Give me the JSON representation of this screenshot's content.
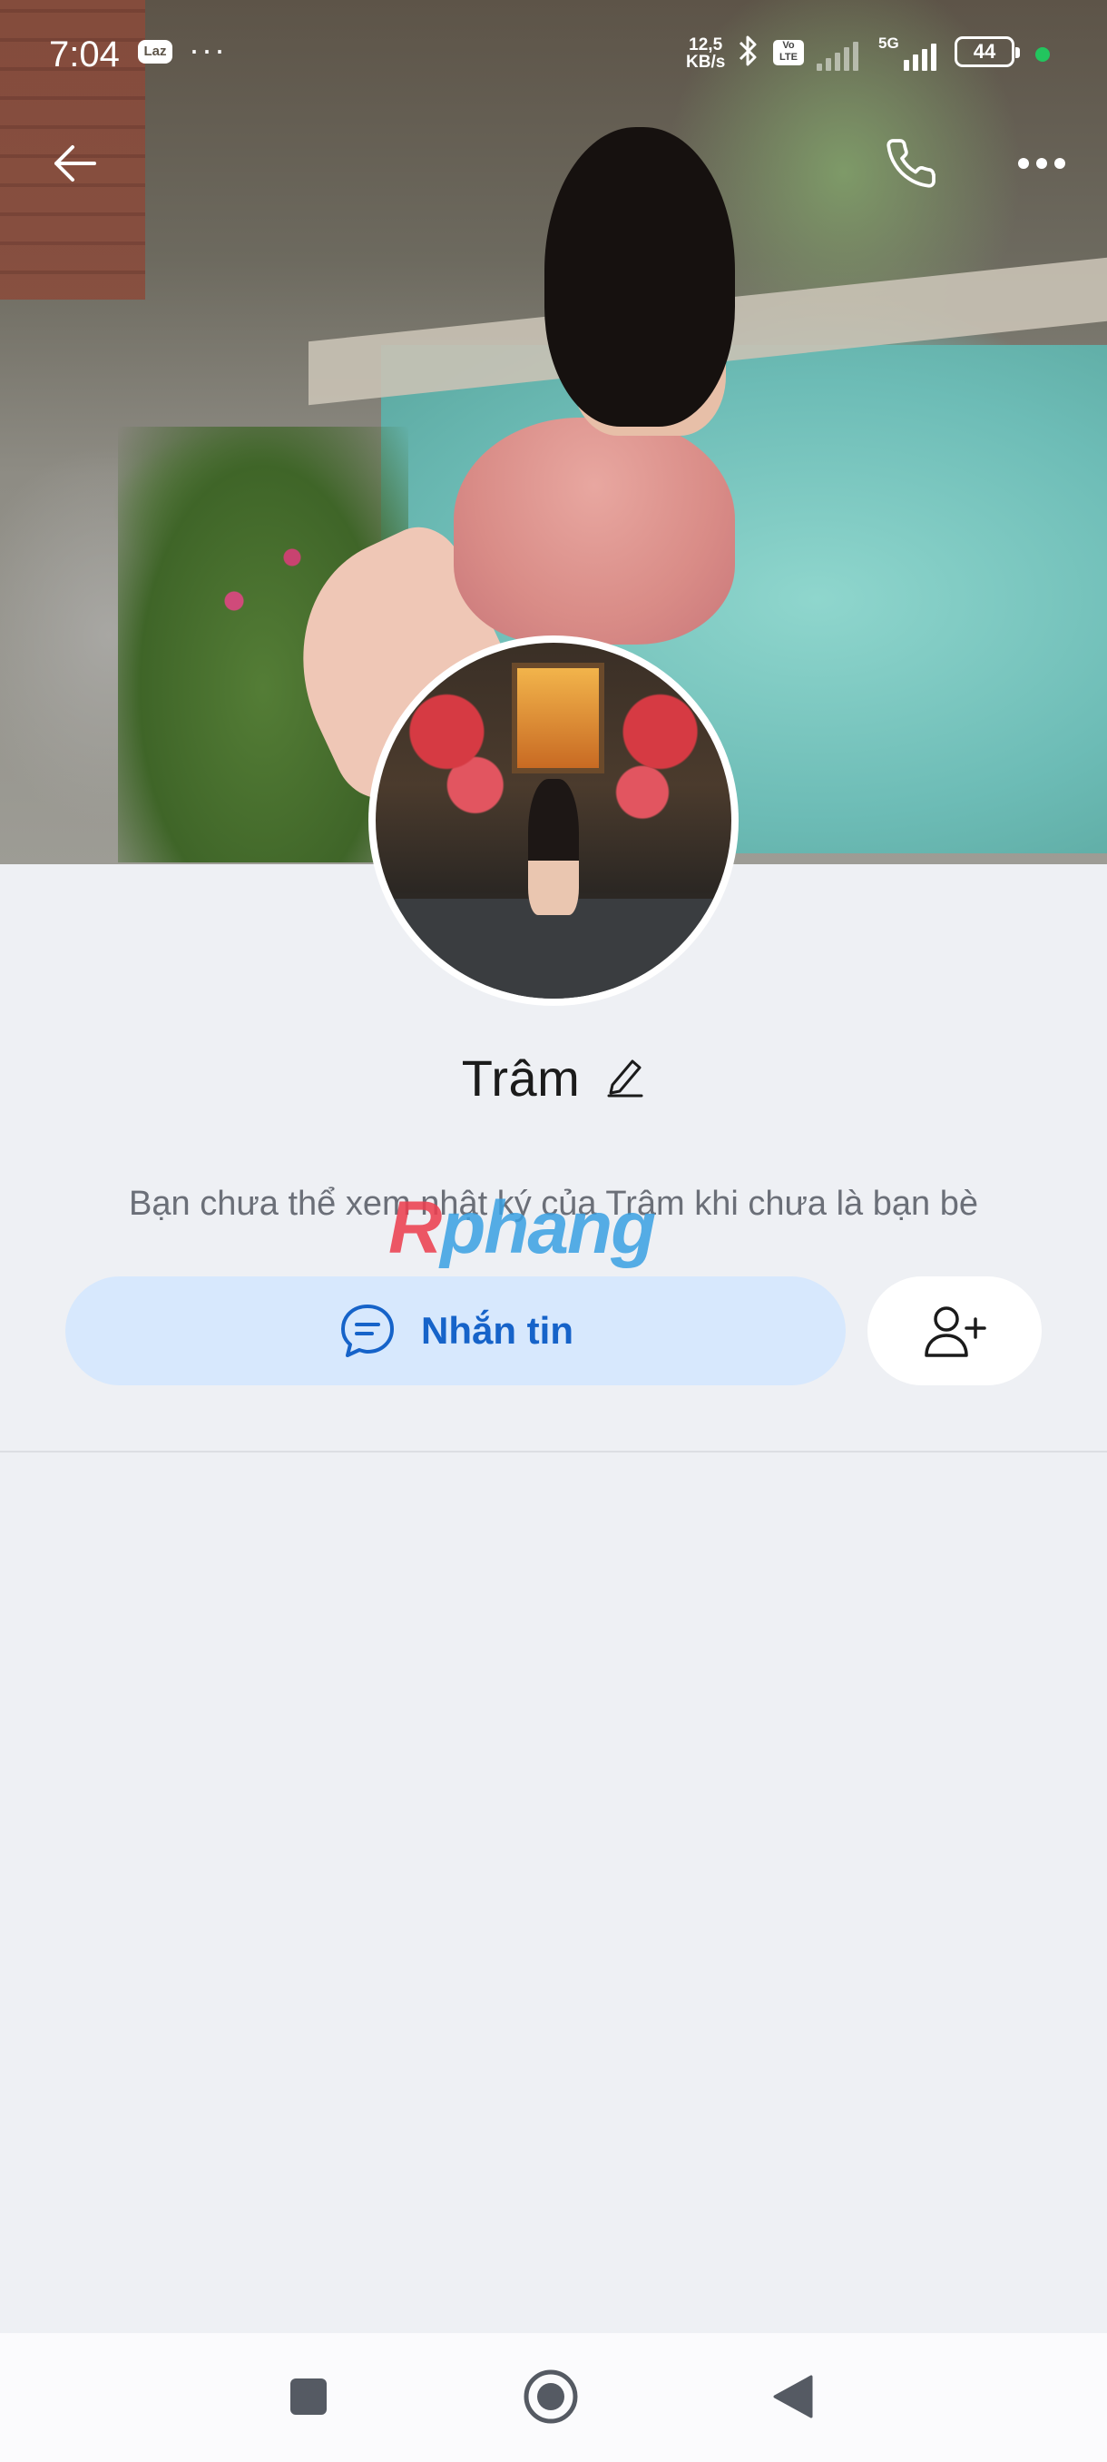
{
  "status_bar": {
    "time": "7:04",
    "app_badge": "Laz",
    "more": "···",
    "speed_value": "12,5",
    "speed_unit": "KB/s",
    "volte": "Vo LTE",
    "network": "5G",
    "battery": "44"
  },
  "profile": {
    "name": "Trâm",
    "notice": "Bạn chưa thể xem nhật ký của Trâm khi chưa là bạn bè"
  },
  "actions": {
    "message_label": "Nhắn tin"
  },
  "watermark": {
    "part1": "R",
    "part2": "phang"
  },
  "icons": {
    "back": "arrow-left-icon",
    "call": "phone-icon",
    "more": "more-horizontal-icon",
    "edit": "pencil-icon",
    "chat": "chat-bubble-icon",
    "add_friend": "user-plus-icon"
  },
  "colors": {
    "accent": "#1663c9",
    "message_button_bg": "#d7e8fd",
    "page_bg": "#eef0f4"
  }
}
